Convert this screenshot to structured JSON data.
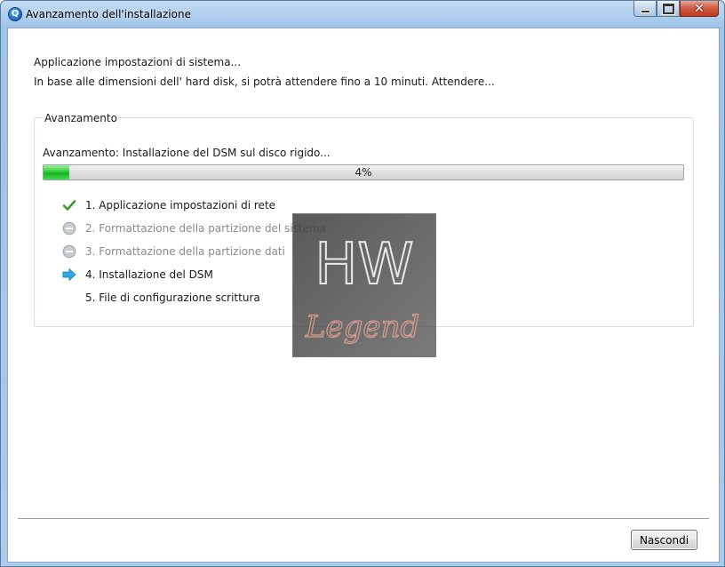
{
  "window": {
    "title": "Avanzamento dell'installazione",
    "app_icon_letter": "Q",
    "close_glyph": "✕"
  },
  "message": {
    "line1": "Applicazione impostazioni di sistema...",
    "line2": "In base alle dimensioni dell' hard disk, si potrà attendere fino a 10 minuti. Attendere..."
  },
  "progress_group": {
    "legend": "Avanzamento",
    "label": "Avanzamento: Installazione del DSM sul disco rigido...",
    "percent_value": 0.04,
    "percent_text": "4%",
    "accent_color": "#1db52a"
  },
  "steps": [
    {
      "label": "1. Applicazione impostazioni di rete",
      "status": "done",
      "icon": "check-icon"
    },
    {
      "label": "2. Formattazione della partizione del sistema",
      "status": "pending",
      "icon": "minus-circle-icon"
    },
    {
      "label": "3. Formattazione della partizione dati",
      "status": "pending",
      "icon": "minus-circle-icon"
    },
    {
      "label": "4. Installazione del DSM",
      "status": "current",
      "icon": "arrow-right-icon"
    },
    {
      "label": "5. File di configurazione scrittura",
      "status": "todo",
      "icon": ""
    }
  ],
  "watermark": {
    "top": "HW",
    "bottom": "Legend"
  },
  "footer": {
    "hide_label": "Nascondi"
  }
}
